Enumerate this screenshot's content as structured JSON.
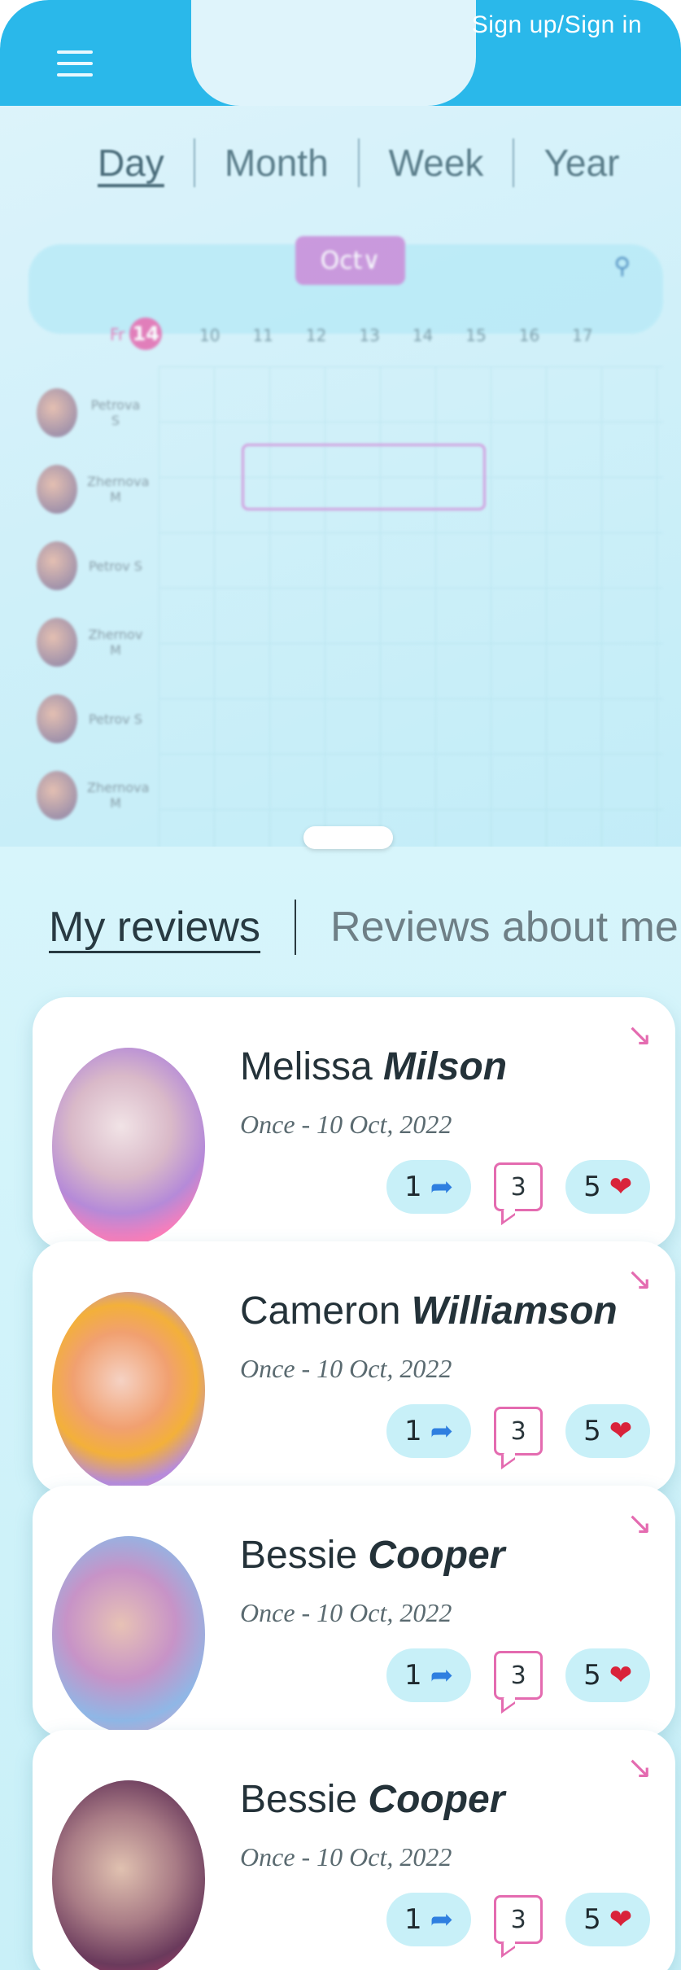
{
  "header": {
    "signin_label": "Sign up/Sign in"
  },
  "periods": [
    "Day",
    "Month",
    "Week",
    "Year"
  ],
  "calendar": {
    "month": "Oct",
    "day_label": "Fr",
    "day_number": "14",
    "hours": [
      "10",
      "11",
      "12",
      "13",
      "14",
      "15",
      "16",
      "17"
    ],
    "people": [
      "Petrova S",
      "Zhernova M",
      "Petrov S",
      "Zhernov M",
      "Petrov S",
      "Zhernova M"
    ]
  },
  "review_tabs": {
    "mine": "My reviews",
    "about": "Reviews about me"
  },
  "colors": {
    "accent_blue": "#2ab8ea",
    "accent_pink": "#e46bb0",
    "heart_red": "#d9233a"
  },
  "reviews": [
    {
      "first": "Melissa",
      "last": "Milson",
      "meta": "Once - 10 Oct, 2022",
      "shares": "1",
      "comments": "3",
      "likes": "5"
    },
    {
      "first": "Cameron",
      "last": "Williamson",
      "meta": "Once - 10 Oct, 2022",
      "shares": "1",
      "comments": "3",
      "likes": "5"
    },
    {
      "first": "Bessie",
      "last": "Cooper",
      "meta": "Once - 10 Oct, 2022",
      "shares": "1",
      "comments": "3",
      "likes": "5"
    },
    {
      "first": "Bessie",
      "last": "Cooper",
      "meta": "Once - 10 Oct, 2022",
      "shares": "1",
      "comments": "3",
      "likes": "5"
    }
  ]
}
